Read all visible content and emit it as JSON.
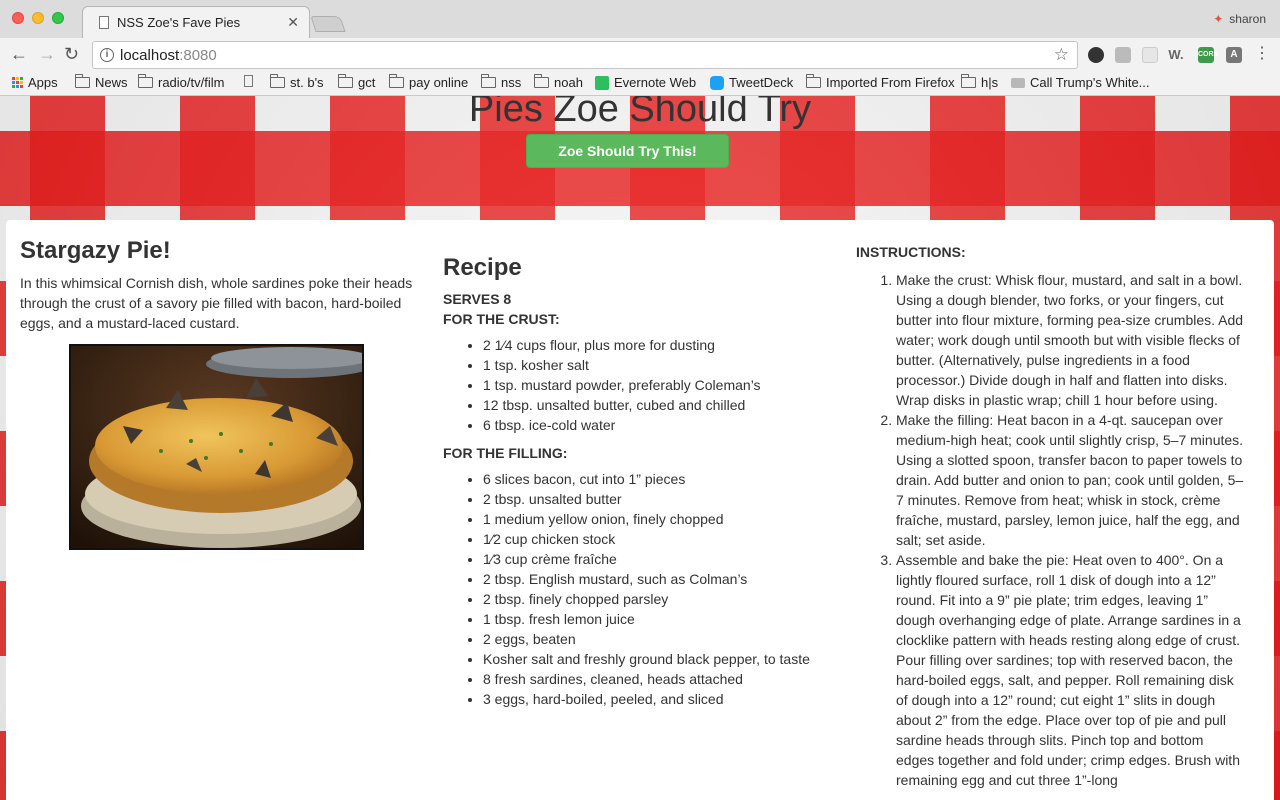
{
  "browser": {
    "tab_title": "NSS Zoe's Fave Pies",
    "tab_close": "✕",
    "profile_name": "sharon",
    "url_host": "localhost",
    "url_port": ":8080",
    "bookmarks": [
      {
        "label": "Apps",
        "icon": "apps-icon"
      },
      {
        "label": "News",
        "icon": "folder-icon"
      },
      {
        "label": "radio/tv/film",
        "icon": "folder-icon"
      },
      {
        "label": "",
        "icon": "page-icon"
      },
      {
        "label": "st. b's",
        "icon": "folder-icon"
      },
      {
        "label": "gct",
        "icon": "folder-icon"
      },
      {
        "label": "pay online",
        "icon": "folder-icon"
      },
      {
        "label": "nss",
        "icon": "folder-icon"
      },
      {
        "label": "noah",
        "icon": "folder-icon"
      },
      {
        "label": "Evernote Web",
        "icon": "evernote-icon"
      },
      {
        "label": "TweetDeck",
        "icon": "tweetdeck-icon"
      },
      {
        "label": "Imported From Firefox",
        "icon": "folder-icon"
      },
      {
        "label": "h|s",
        "icon": "folder-icon"
      },
      {
        "label": "Call Trump's White...",
        "icon": "whitehouse-icon"
      }
    ]
  },
  "page": {
    "title": "Pies Zoe Should Try",
    "try_button": "Zoe Should Try This!",
    "pie": {
      "name": "Stargazy Pie!",
      "description": "In this whimsical Cornish dish, whole sardines poke their heads through the crust of a savory pie filled with bacon, hard-boiled eggs, and a mustard-laced custard."
    },
    "recipe": {
      "heading": "Recipe",
      "serves": "SERVES 8",
      "crust_heading": "FOR THE CRUST:",
      "crust": [
        "2 1⁄4 cups flour, plus more for dusting",
        "1 tsp. kosher salt",
        "1 tsp. mustard powder, preferably Coleman’s",
        "12 tbsp. unsalted butter, cubed and chilled",
        "6 tbsp. ice-cold water"
      ],
      "filling_heading": "FOR THE FILLING:",
      "filling": [
        "6 slices bacon, cut into 1” pieces",
        "2 tbsp. unsalted butter",
        "1 medium yellow onion, finely chopped",
        "1⁄2 cup chicken stock",
        "1⁄3 cup crème fraîche",
        "2 tbsp. English mustard, such as Colman’s",
        "2 tbsp. finely chopped parsley",
        "1 tbsp. fresh lemon juice",
        "2 eggs, beaten",
        "Kosher salt and freshly ground black pepper, to taste",
        "8 fresh sardines, cleaned, heads attached",
        "3 eggs, hard-boiled, peeled, and sliced"
      ]
    },
    "instructions": {
      "heading": "INSTRUCTIONS:",
      "steps": [
        "Make the crust: Whisk flour, mustard, and salt in a bowl. Using a dough blender, two forks, or your fingers, cut butter into flour mixture, forming pea-size crumbles. Add water; work dough until smooth but with visible flecks of butter. (Alternatively, pulse ingredients in a food processor.) Divide dough in half and flatten into disks. Wrap disks in plastic wrap; chill 1 hour before using.",
        "Make the filling: Heat bacon in a 4-qt. saucepan over medium-high heat; cook until slightly crisp, 5–7 minutes. Using a slotted spoon, transfer bacon to paper towels to drain. Add butter and onion to pan; cook until golden, 5–7 minutes. Remove from heat; whisk in stock, crème fraîche, mustard, parsley, lemon juice, half the egg, and salt; set aside.",
        "Assemble and bake the pie: Heat oven to 400°. On a lightly floured surface, roll 1 disk of dough into a 12” round. Fit into a 9” pie plate; trim edges, leaving 1” dough overhanging edge of plate. Arrange sardines in a clocklike pattern with heads resting along edge of crust. Pour filling over sardines; top with reserved bacon, the hard-boiled eggs, salt, and pepper. Roll remaining disk of dough into a 12” round; cut eight 1” slits in dough about 2” from the edge. Place over top of pie and pull sardine heads through slits. Pinch top and bottom edges together and fold under; crimp edges. Brush with remaining egg and cut three 1”-long"
      ]
    }
  }
}
